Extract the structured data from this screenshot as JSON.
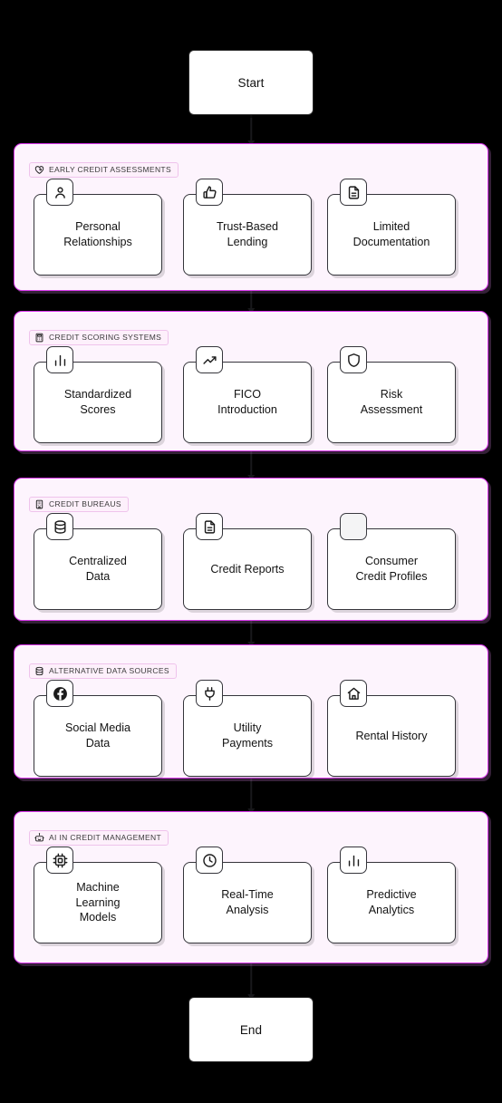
{
  "theme": {
    "canvas_bg": "#000000",
    "section_bg": "#fdf4fd",
    "section_border": "#d936ed",
    "node_bg": "#ffffff",
    "node_border": "#35353b",
    "text": "#131313"
  },
  "start_node": {
    "label": "Start"
  },
  "end_node": {
    "label": "End"
  },
  "sections": [
    {
      "badge_label": "EARLY CREDIT ASSESSMENTS",
      "badge_icon": "heart-handshake-icon",
      "cards": [
        {
          "label": "Personal\nRelationships",
          "icon": "user-icon"
        },
        {
          "label": "Trust-Based\nLending",
          "icon": "thumbs-up-icon"
        },
        {
          "label": "Limited\nDocumentation",
          "icon": "file-text-icon"
        }
      ]
    },
    {
      "badge_label": "CREDIT SCORING SYSTEMS",
      "badge_icon": "calculator-icon",
      "cards": [
        {
          "label": "Standardized\nScores",
          "icon": "bar-chart-icon"
        },
        {
          "label": "FICO\nIntroduction",
          "icon": "trending-up-icon"
        },
        {
          "label": "Risk\nAssessment",
          "icon": "shield-icon"
        }
      ]
    },
    {
      "badge_label": "CREDIT BUREAUS",
      "badge_icon": "building-icon",
      "cards": [
        {
          "label": "Centralized\nData",
          "icon": "database-icon"
        },
        {
          "label": "Credit Reports",
          "icon": "file-text-icon"
        },
        {
          "label": "Consumer\nCredit Profiles",
          "icon": "blank-icon"
        }
      ]
    },
    {
      "badge_label": "ALTERNATIVE DATA SOURCES",
      "badge_icon": "database-icon",
      "cards": [
        {
          "label": "Social Media\nData",
          "icon": "facebook-icon"
        },
        {
          "label": "Utility\nPayments",
          "icon": "plug-icon"
        },
        {
          "label": "Rental History",
          "icon": "home-icon"
        }
      ]
    },
    {
      "badge_label": "AI IN CREDIT MANAGEMENT",
      "badge_icon": "bot-icon",
      "cards": [
        {
          "label": "Machine\nLearning\nModels",
          "icon": "cpu-icon"
        },
        {
          "label": "Real-Time\nAnalysis",
          "icon": "clock-icon"
        },
        {
          "label": "Predictive\nAnalytics",
          "icon": "bar-chart-icon"
        }
      ]
    }
  ]
}
